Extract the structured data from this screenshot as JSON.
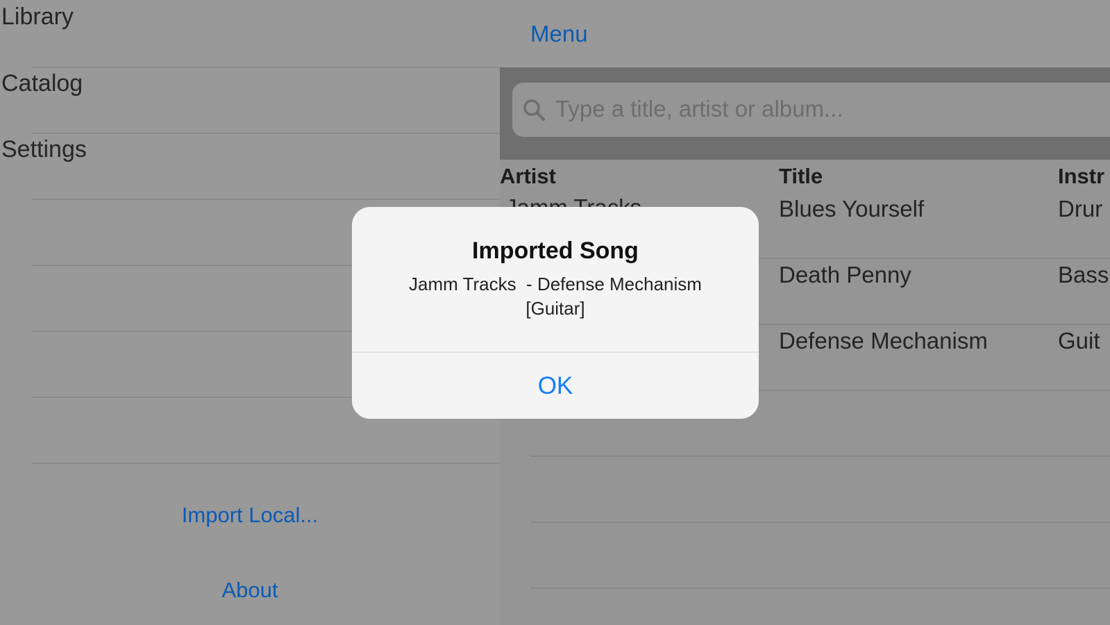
{
  "sidebar": {
    "items": [
      {
        "label": "Library"
      },
      {
        "label": "Catalog"
      },
      {
        "label": "Settings"
      }
    ],
    "import_local": "Import Local...",
    "about": "About"
  },
  "main": {
    "menu_label": "Menu",
    "search": {
      "placeholder": "Type a title, artist or album...",
      "icon": "search-icon"
    },
    "columns": [
      "Artist",
      "Title",
      "Instr"
    ],
    "rows": [
      {
        "artist": "Jamm Tracks",
        "title": "Blues Yourself",
        "instrument": "Drur"
      },
      {
        "artist": "",
        "title": "Death Penny",
        "instrument": "Bass"
      },
      {
        "artist": "",
        "title": "Defense Mechanism",
        "instrument": "Guit"
      }
    ]
  },
  "alert": {
    "title": "Imported Song",
    "message": "Jamm Tracks  - Defense Mechanism\n[Guitar]",
    "ok_label": "OK"
  },
  "colors": {
    "accent": "#157efb",
    "link": "#0b5bb5",
    "dim_background": "#999999"
  }
}
